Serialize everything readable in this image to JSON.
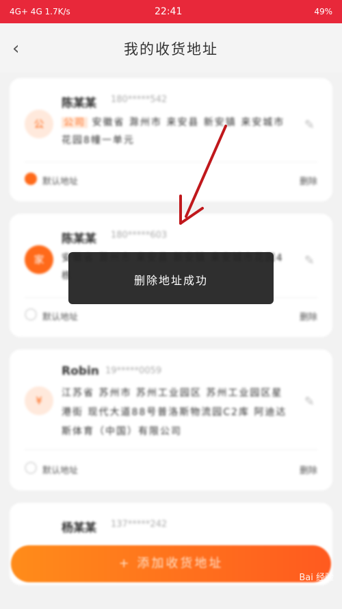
{
  "status": {
    "left": "4G+ 4G 1.7K/s",
    "time": "22:41",
    "right": "49%"
  },
  "header": {
    "back_icon": "‹",
    "title": "我的收货地址"
  },
  "cards": [
    {
      "name": "陈某某",
      "phone": "180*****542",
      "tag": "公司",
      "address": "安徽省 滁州市 来安县 新安镇 来安城市花园8幢一单元",
      "icon": "公",
      "default_label": "默认地址",
      "delete_label": "删除"
    },
    {
      "name": "陈某某",
      "phone": "180*****603",
      "address": "安徽省 滁州市 来安县 新安镇 来安城市花园4栋",
      "icon": "家",
      "default_label": "默认地址",
      "delete_label": "删除"
    },
    {
      "name": "Robin",
      "phone": "19*****0059",
      "address": "江苏省 苏州市 苏州工业园区 苏州工业园区星港街 现代大道88号普洛斯物流园C2库 阿迪达斯体育（中国）有限公司",
      "icon": "¥",
      "default_label": "默认地址",
      "delete_label": "删除"
    },
    {
      "name": "杨某某",
      "phone": "137*****242"
    }
  ],
  "toast": {
    "text": "删除地址成功"
  },
  "footer": {
    "add_button": "+ 添加收货地址"
  },
  "watermark": "Bai 经验"
}
